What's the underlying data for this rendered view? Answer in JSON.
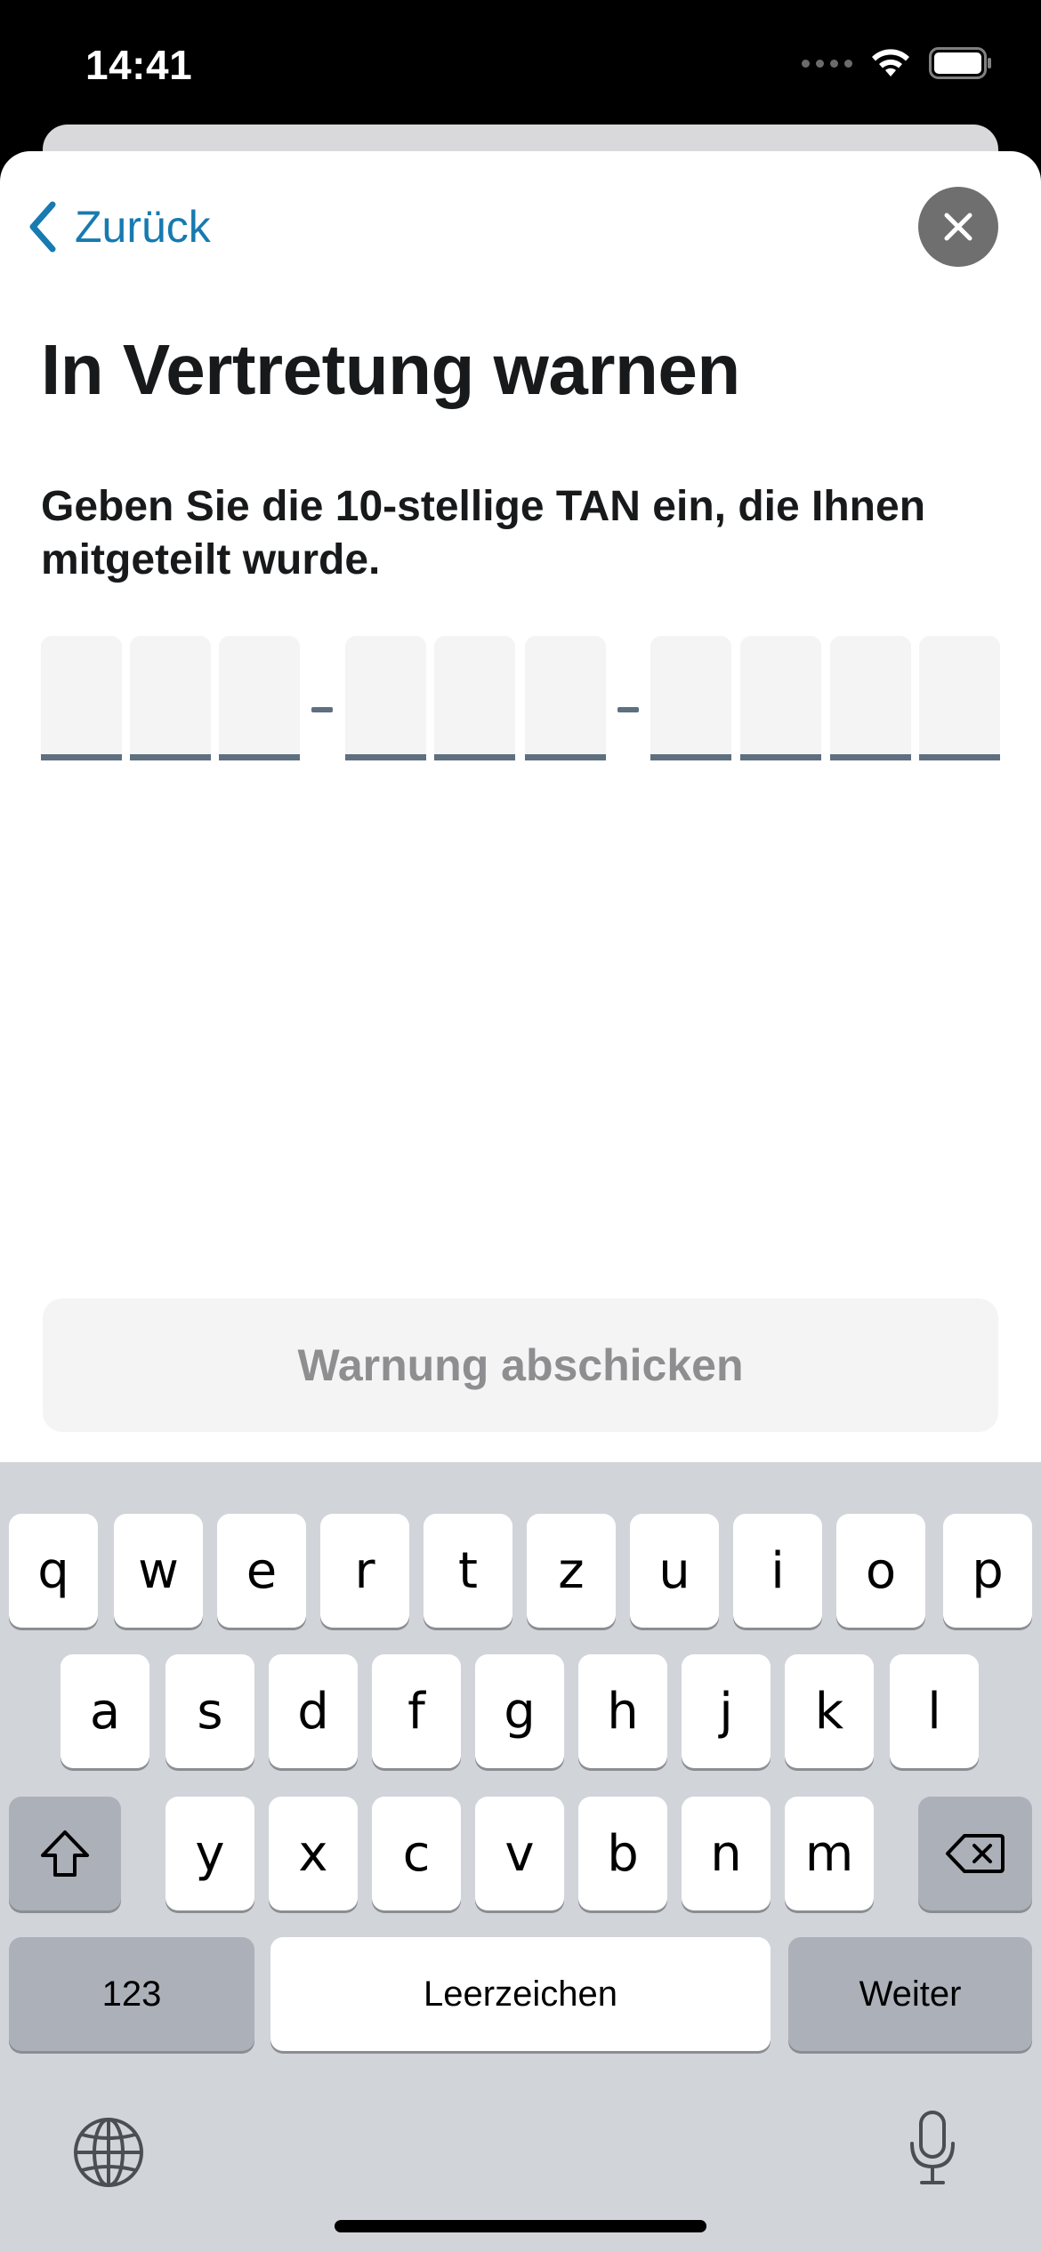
{
  "status_bar": {
    "time": "14:41"
  },
  "header": {
    "back_label": "Zurück"
  },
  "title": "In Vertretung warnen",
  "instruction": "Geben Sie die 10-stellige TAN ein, die Ihnen mitgeteilt wurde.",
  "tan": {
    "digits": [
      "",
      "",
      "",
      "",
      "",
      "",
      "",
      "",
      "",
      ""
    ],
    "separator": "-"
  },
  "submit_label": "Warnung abschicken",
  "keyboard": {
    "row1": [
      "q",
      "w",
      "e",
      "r",
      "t",
      "z",
      "u",
      "i",
      "o",
      "p"
    ],
    "row2": [
      "a",
      "s",
      "d",
      "f",
      "g",
      "h",
      "j",
      "k",
      "l"
    ],
    "row3": [
      "y",
      "x",
      "c",
      "v",
      "b",
      "n",
      "m"
    ],
    "numbers_label": "123",
    "space_label": "Leerzeichen",
    "return_label": "Weiter"
  },
  "icons": {
    "back": "chevron-left-icon",
    "close": "close-icon",
    "shift": "shift-icon",
    "delete": "backspace-icon",
    "globe": "globe-icon",
    "mic": "microphone-icon"
  },
  "colors": {
    "accent": "#177ab0",
    "tan_underline": "#5e6f80",
    "keyboard_bg": "#d1d4d9"
  }
}
